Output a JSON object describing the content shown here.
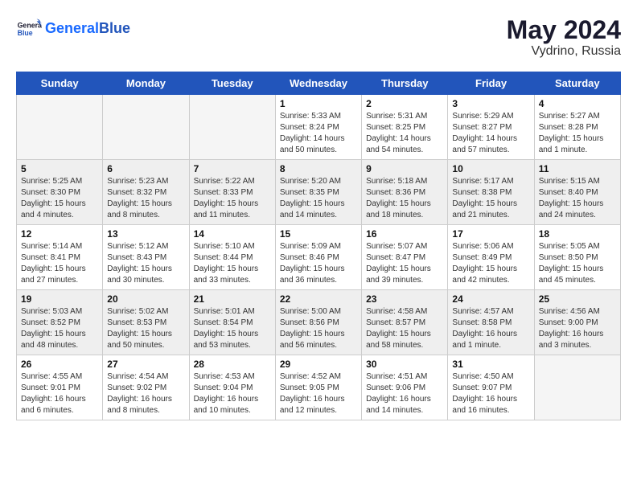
{
  "header": {
    "logo_general": "General",
    "logo_blue": "Blue",
    "title": "May 2024",
    "location": "Vydrino, Russia"
  },
  "days_of_week": [
    "Sunday",
    "Monday",
    "Tuesday",
    "Wednesday",
    "Thursday",
    "Friday",
    "Saturday"
  ],
  "weeks": [
    [
      {
        "day": "",
        "info": ""
      },
      {
        "day": "",
        "info": ""
      },
      {
        "day": "",
        "info": ""
      },
      {
        "day": "1",
        "info": "Sunrise: 5:33 AM\nSunset: 8:24 PM\nDaylight: 14 hours\nand 50 minutes."
      },
      {
        "day": "2",
        "info": "Sunrise: 5:31 AM\nSunset: 8:25 PM\nDaylight: 14 hours\nand 54 minutes."
      },
      {
        "day": "3",
        "info": "Sunrise: 5:29 AM\nSunset: 8:27 PM\nDaylight: 14 hours\nand 57 minutes."
      },
      {
        "day": "4",
        "info": "Sunrise: 5:27 AM\nSunset: 8:28 PM\nDaylight: 15 hours\nand 1 minute."
      }
    ],
    [
      {
        "day": "5",
        "info": "Sunrise: 5:25 AM\nSunset: 8:30 PM\nDaylight: 15 hours\nand 4 minutes."
      },
      {
        "day": "6",
        "info": "Sunrise: 5:23 AM\nSunset: 8:32 PM\nDaylight: 15 hours\nand 8 minutes."
      },
      {
        "day": "7",
        "info": "Sunrise: 5:22 AM\nSunset: 8:33 PM\nDaylight: 15 hours\nand 11 minutes."
      },
      {
        "day": "8",
        "info": "Sunrise: 5:20 AM\nSunset: 8:35 PM\nDaylight: 15 hours\nand 14 minutes."
      },
      {
        "day": "9",
        "info": "Sunrise: 5:18 AM\nSunset: 8:36 PM\nDaylight: 15 hours\nand 18 minutes."
      },
      {
        "day": "10",
        "info": "Sunrise: 5:17 AM\nSunset: 8:38 PM\nDaylight: 15 hours\nand 21 minutes."
      },
      {
        "day": "11",
        "info": "Sunrise: 5:15 AM\nSunset: 8:40 PM\nDaylight: 15 hours\nand 24 minutes."
      }
    ],
    [
      {
        "day": "12",
        "info": "Sunrise: 5:14 AM\nSunset: 8:41 PM\nDaylight: 15 hours\nand 27 minutes."
      },
      {
        "day": "13",
        "info": "Sunrise: 5:12 AM\nSunset: 8:43 PM\nDaylight: 15 hours\nand 30 minutes."
      },
      {
        "day": "14",
        "info": "Sunrise: 5:10 AM\nSunset: 8:44 PM\nDaylight: 15 hours\nand 33 minutes."
      },
      {
        "day": "15",
        "info": "Sunrise: 5:09 AM\nSunset: 8:46 PM\nDaylight: 15 hours\nand 36 minutes."
      },
      {
        "day": "16",
        "info": "Sunrise: 5:07 AM\nSunset: 8:47 PM\nDaylight: 15 hours\nand 39 minutes."
      },
      {
        "day": "17",
        "info": "Sunrise: 5:06 AM\nSunset: 8:49 PM\nDaylight: 15 hours\nand 42 minutes."
      },
      {
        "day": "18",
        "info": "Sunrise: 5:05 AM\nSunset: 8:50 PM\nDaylight: 15 hours\nand 45 minutes."
      }
    ],
    [
      {
        "day": "19",
        "info": "Sunrise: 5:03 AM\nSunset: 8:52 PM\nDaylight: 15 hours\nand 48 minutes."
      },
      {
        "day": "20",
        "info": "Sunrise: 5:02 AM\nSunset: 8:53 PM\nDaylight: 15 hours\nand 50 minutes."
      },
      {
        "day": "21",
        "info": "Sunrise: 5:01 AM\nSunset: 8:54 PM\nDaylight: 15 hours\nand 53 minutes."
      },
      {
        "day": "22",
        "info": "Sunrise: 5:00 AM\nSunset: 8:56 PM\nDaylight: 15 hours\nand 56 minutes."
      },
      {
        "day": "23",
        "info": "Sunrise: 4:58 AM\nSunset: 8:57 PM\nDaylight: 15 hours\nand 58 minutes."
      },
      {
        "day": "24",
        "info": "Sunrise: 4:57 AM\nSunset: 8:58 PM\nDaylight: 16 hours\nand 1 minute."
      },
      {
        "day": "25",
        "info": "Sunrise: 4:56 AM\nSunset: 9:00 PM\nDaylight: 16 hours\nand 3 minutes."
      }
    ],
    [
      {
        "day": "26",
        "info": "Sunrise: 4:55 AM\nSunset: 9:01 PM\nDaylight: 16 hours\nand 6 minutes."
      },
      {
        "day": "27",
        "info": "Sunrise: 4:54 AM\nSunset: 9:02 PM\nDaylight: 16 hours\nand 8 minutes."
      },
      {
        "day": "28",
        "info": "Sunrise: 4:53 AM\nSunset: 9:04 PM\nDaylight: 16 hours\nand 10 minutes."
      },
      {
        "day": "29",
        "info": "Sunrise: 4:52 AM\nSunset: 9:05 PM\nDaylight: 16 hours\nand 12 minutes."
      },
      {
        "day": "30",
        "info": "Sunrise: 4:51 AM\nSunset: 9:06 PM\nDaylight: 16 hours\nand 14 minutes."
      },
      {
        "day": "31",
        "info": "Sunrise: 4:50 AM\nSunset: 9:07 PM\nDaylight: 16 hours\nand 16 minutes."
      },
      {
        "day": "",
        "info": ""
      }
    ]
  ]
}
